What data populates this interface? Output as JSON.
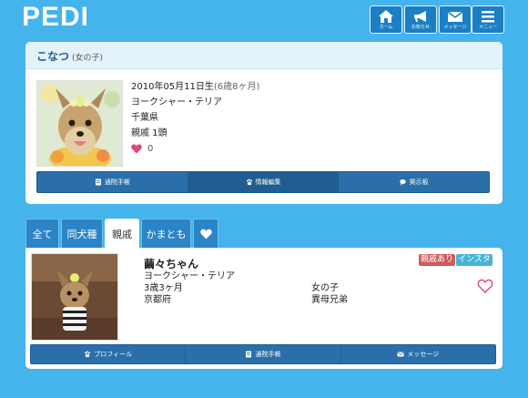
{
  "header": {
    "logo": "PEDI",
    "nav": [
      {
        "label": "ホーム",
        "icon": "home-icon"
      },
      {
        "label": "お知らせ",
        "icon": "megaphone-icon"
      },
      {
        "label": "メッセージ",
        "icon": "envelope-icon"
      },
      {
        "label": "メニュー",
        "icon": "menu-icon"
      }
    ]
  },
  "profile": {
    "name": "こなつ",
    "gender": "(女の子)",
    "birthday": "2010年05月11日生",
    "age": "(6歳8ヶ月)",
    "breed": "ヨークシャー・テリア",
    "prefecture": "千葉県",
    "relatives": "親戚 1頭",
    "likes": "0",
    "buttons": [
      {
        "label": "通院手帳",
        "icon": "notebook-icon"
      },
      {
        "label": "情報編集",
        "icon": "paw-icon"
      },
      {
        "label": "掲示板",
        "icon": "comments-icon"
      }
    ]
  },
  "tabs": [
    {
      "label": "全て"
    },
    {
      "label": "同犬種"
    },
    {
      "label": "親戚"
    },
    {
      "label": "かまとも"
    },
    {
      "label": "",
      "icon": "heart-icon"
    }
  ],
  "family": {
    "name": "繭々ちゃん",
    "breed": "ヨークシャー・テリア",
    "age": "3歳3ヶ月",
    "prefecture": "京都府",
    "gender": "女の子",
    "relation": "異母兄弟",
    "badges": [
      "親戚あり",
      "インスタ"
    ],
    "buttons": [
      {
        "label": "プロフィール",
        "icon": "paw-icon"
      },
      {
        "label": "通院手帳",
        "icon": "notebook-icon"
      },
      {
        "label": "メッセージ",
        "icon": "envelope-icon"
      }
    ]
  },
  "colors": {
    "background": "#45b3ec",
    "nav_button": "#1b7fc3",
    "action_button": "#2a6fa9",
    "heart": "#e0457b",
    "badge_relative": "#d15b5b",
    "badge_insta": "#45b5d8"
  }
}
